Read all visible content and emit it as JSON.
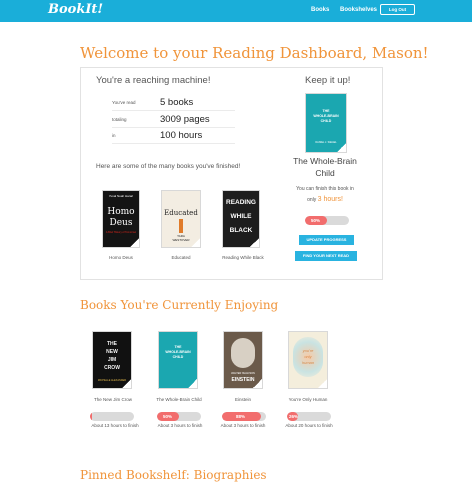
{
  "nav": {
    "brand": "BookIt!",
    "links": [
      "Books",
      "Bookshelves"
    ],
    "logout": "Log Out"
  },
  "welcome": "Welcome to your Reading Dashboard, Mason!",
  "stats": {
    "title": "You're a reaching machine!",
    "rows": [
      {
        "label": "You've read",
        "value": "5 books"
      },
      {
        "label": "totaling",
        "value": "3009 pages"
      },
      {
        "label": "in",
        "value": "100 hours"
      }
    ]
  },
  "finished": {
    "caption": "Here are some of the many books you've finished!",
    "books": [
      {
        "title": "Homo Deus",
        "cover_lines": [
          "Yuval Noah Harari",
          "Homo",
          "Deus",
          "A Brief History of Tomorrow"
        ],
        "bg": "#141414",
        "fg": "#ffffff",
        "accent": "#e1261c"
      },
      {
        "title": "Educated",
        "cover_lines": [
          "Educated",
          "TARA",
          "WESTOVER"
        ],
        "bg": "#f3ede2",
        "fg": "#222222",
        "accent": "#e07b2a"
      },
      {
        "title": "Reading While Black",
        "cover_lines": [
          "READING",
          "WHILE",
          "BLACK"
        ],
        "bg": "#1d1d1d",
        "fg": "#ffffff",
        "accent": "#555555"
      }
    ]
  },
  "current": {
    "heading": "Keep it up!",
    "title": "The Whole-Brain Child",
    "cover_lines": [
      "THE",
      "WHOLE-BRAIN",
      "CHILD",
      "DANIEL J. SIEGEL"
    ],
    "finish_prefix": "You can finish this book in",
    "finish_only": "only",
    "finish_hours": "3 hours!",
    "progress_label": "50%",
    "progress": 0.5,
    "update_button": "UPDATE PROGRESS",
    "find_button": "FIND YOUR NEXT READ"
  },
  "enjoying": {
    "heading": "Books You're Currently Enjoying",
    "books": [
      {
        "title": "The New Jim Crow",
        "cover_lines": [
          "THE",
          "NEW",
          "JIM",
          "CROW",
          "MICHELLE ALEXANDER"
        ],
        "bg": "#111111",
        "fg": "#f1f1f1",
        "progress": 0.05,
        "progress_label": "",
        "hours": "About 13 hours to finish"
      },
      {
        "title": "The Whole-Brain Child",
        "cover_lines": [
          "THE",
          "WHOLE-BRAIN",
          "CHILD"
        ],
        "bg": "#1ba7b0",
        "fg": "#ffffff",
        "progress": 0.5,
        "progress_label": "50%",
        "hours": "About 3 hours to finish"
      },
      {
        "title": "Einstein",
        "cover_lines": [
          "WALTER ISAACSON",
          "EINSTEIN"
        ],
        "bg": "#6b5a4a",
        "fg": "#ffffff",
        "progress": 0.88,
        "progress_label": "88%",
        "hours": "About 3 hours to finish"
      },
      {
        "title": "You're Only Human",
        "cover_lines": [
          "you're",
          "only",
          "human"
        ],
        "bg": "#f4eedc",
        "fg": "#d98a4a",
        "progress": 0.26,
        "progress_label": "26%",
        "hours": "About 20 hours to finish"
      }
    ]
  },
  "pinned": {
    "heading": "Pinned Bookshelf: Biographies"
  },
  "colors": {
    "nav": "#1aaed9",
    "accent_orange": "#f0943a",
    "progress_red": "#f26d6d",
    "button_blue": "#29b3e0"
  }
}
